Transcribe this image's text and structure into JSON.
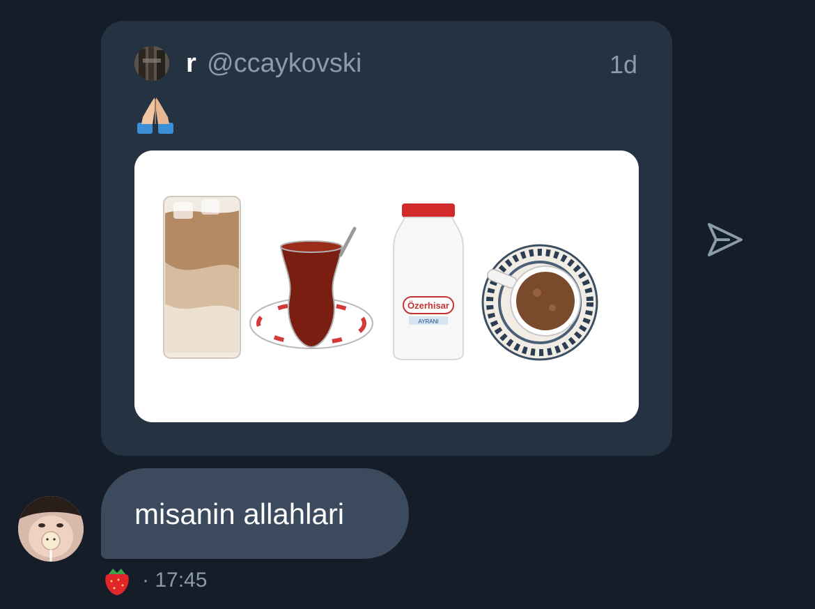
{
  "quoted_post": {
    "author_name": "r",
    "author_handle": "@ccaykovski",
    "age": "1d",
    "emoji": "🙏",
    "media_items": [
      "iced-latte-image",
      "turkish-tea-image",
      "ayran-bottle-image",
      "turkish-coffee-image"
    ],
    "bottle_label_brand": "Özerhisar",
    "bottle_label_sub": "AYRANI"
  },
  "share_icon": "send-icon",
  "message": {
    "text": "misanin allahlari",
    "reaction": "🍓",
    "timestamp": "· 17:45"
  },
  "colors": {
    "background": "#151d28",
    "card": "#253241",
    "bubble": "#3b4a5c",
    "muted_text": "#8a9bab"
  }
}
